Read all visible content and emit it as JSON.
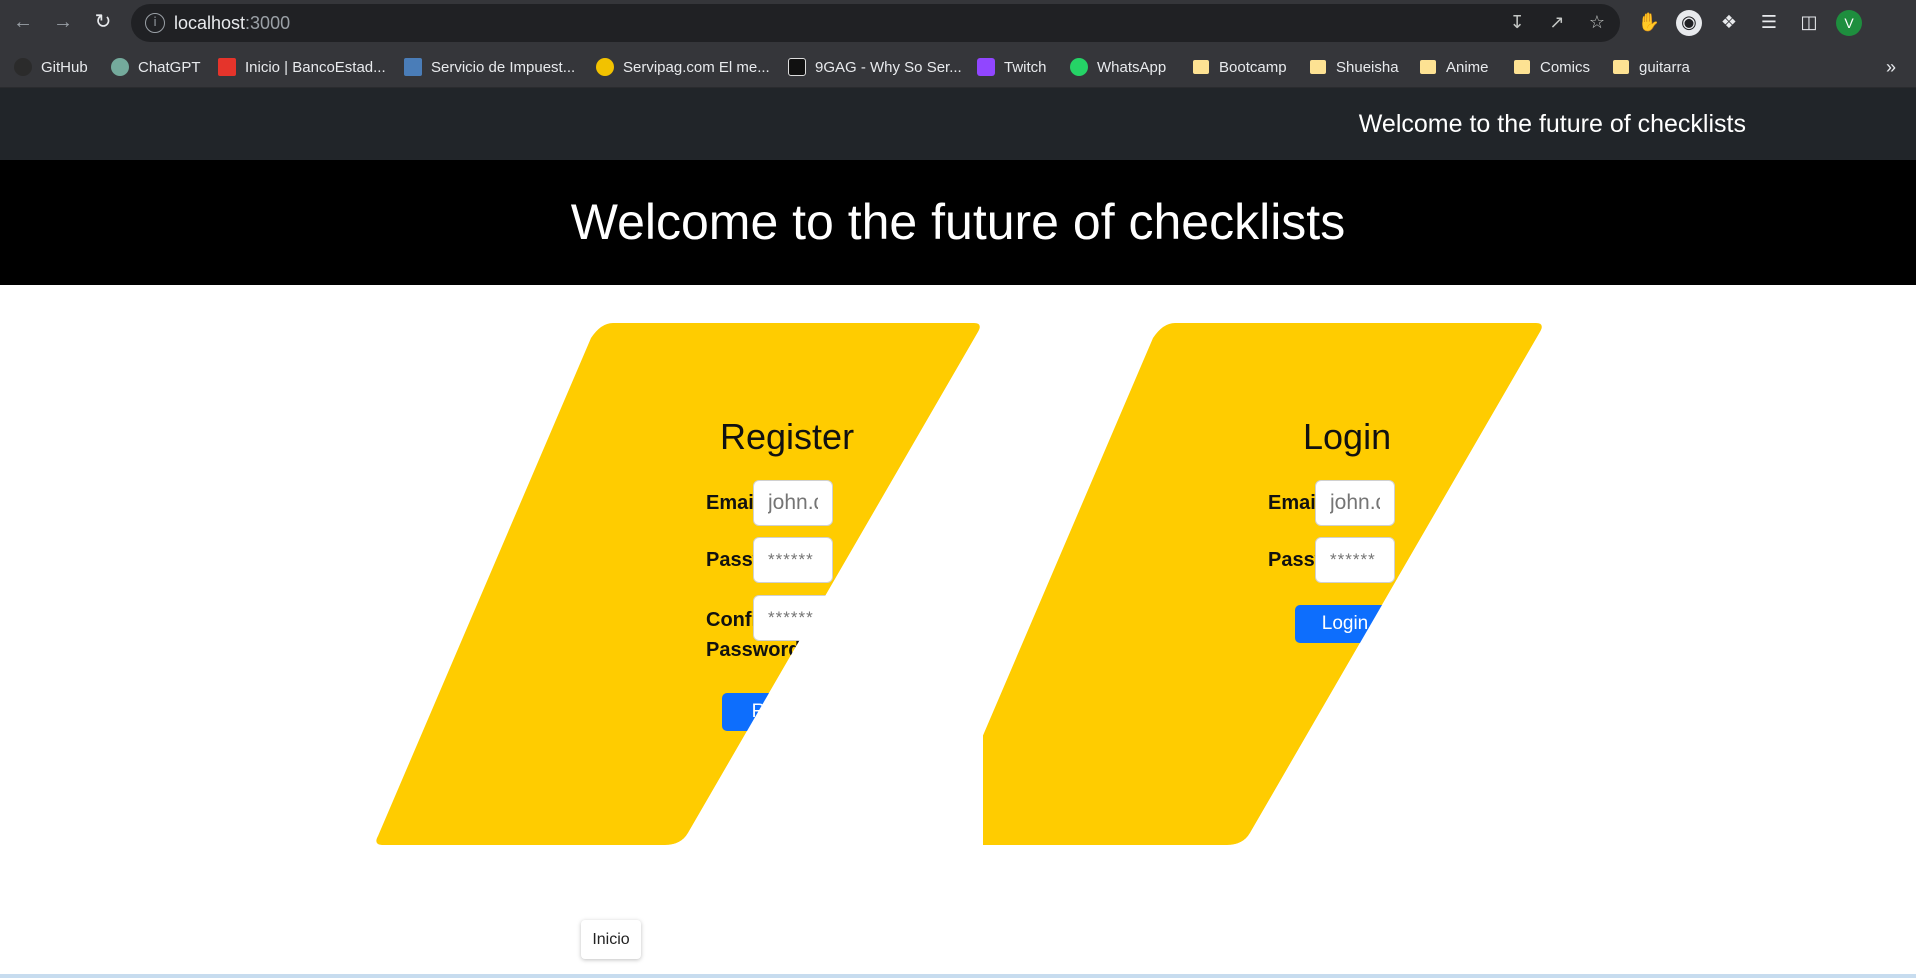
{
  "browser": {
    "url_host": "localhost",
    "url_port": ":3000",
    "profile_initial": "V",
    "bookmarks": [
      {
        "label": "GitHub",
        "color": "#2b2b2b"
      },
      {
        "label": "ChatGPT",
        "color": "#74aa9c"
      },
      {
        "label": "Inicio | BancoEstad...",
        "color": "#e5342b"
      },
      {
        "label": "Servicio de Impuest...",
        "color": "#4a7db8"
      },
      {
        "label": "Servipag.com El me...",
        "color": "#f2c200"
      },
      {
        "label": "9GAG - Why So Ser...",
        "color": "#111111"
      },
      {
        "label": "Twitch",
        "color": "#9146ff"
      },
      {
        "label": "WhatsApp",
        "color": "#25d366"
      },
      {
        "label": "Bootcamp",
        "color": "folder"
      },
      {
        "label": "Shueisha",
        "color": "folder"
      },
      {
        "label": "Anime",
        "color": "folder"
      },
      {
        "label": "Comics",
        "color": "folder"
      },
      {
        "label": "guitarra",
        "color": "folder"
      }
    ]
  },
  "navbar": {
    "text": "Welcome to the future of checklists"
  },
  "hero": {
    "title": "Welcome to the future of checklists"
  },
  "register": {
    "title": "Register",
    "email_label": "Email",
    "email_placeholder": "john.doe@example.com",
    "password_label": "Password",
    "password_placeholder": "******",
    "confirm_label": "Confirm Password",
    "confirm_placeholder": "******",
    "button_label": "Register"
  },
  "login": {
    "title": "Login",
    "email_label": "Email",
    "email_placeholder": "john.doe@example.com",
    "password_label": "Password",
    "password_placeholder": "******",
    "button_label": "Login"
  },
  "tooltip": {
    "text": "Inicio"
  },
  "colors": {
    "card_yellow": "#ffcc00",
    "button_blue": "#0d6efd",
    "navbar_dark": "#212529"
  }
}
